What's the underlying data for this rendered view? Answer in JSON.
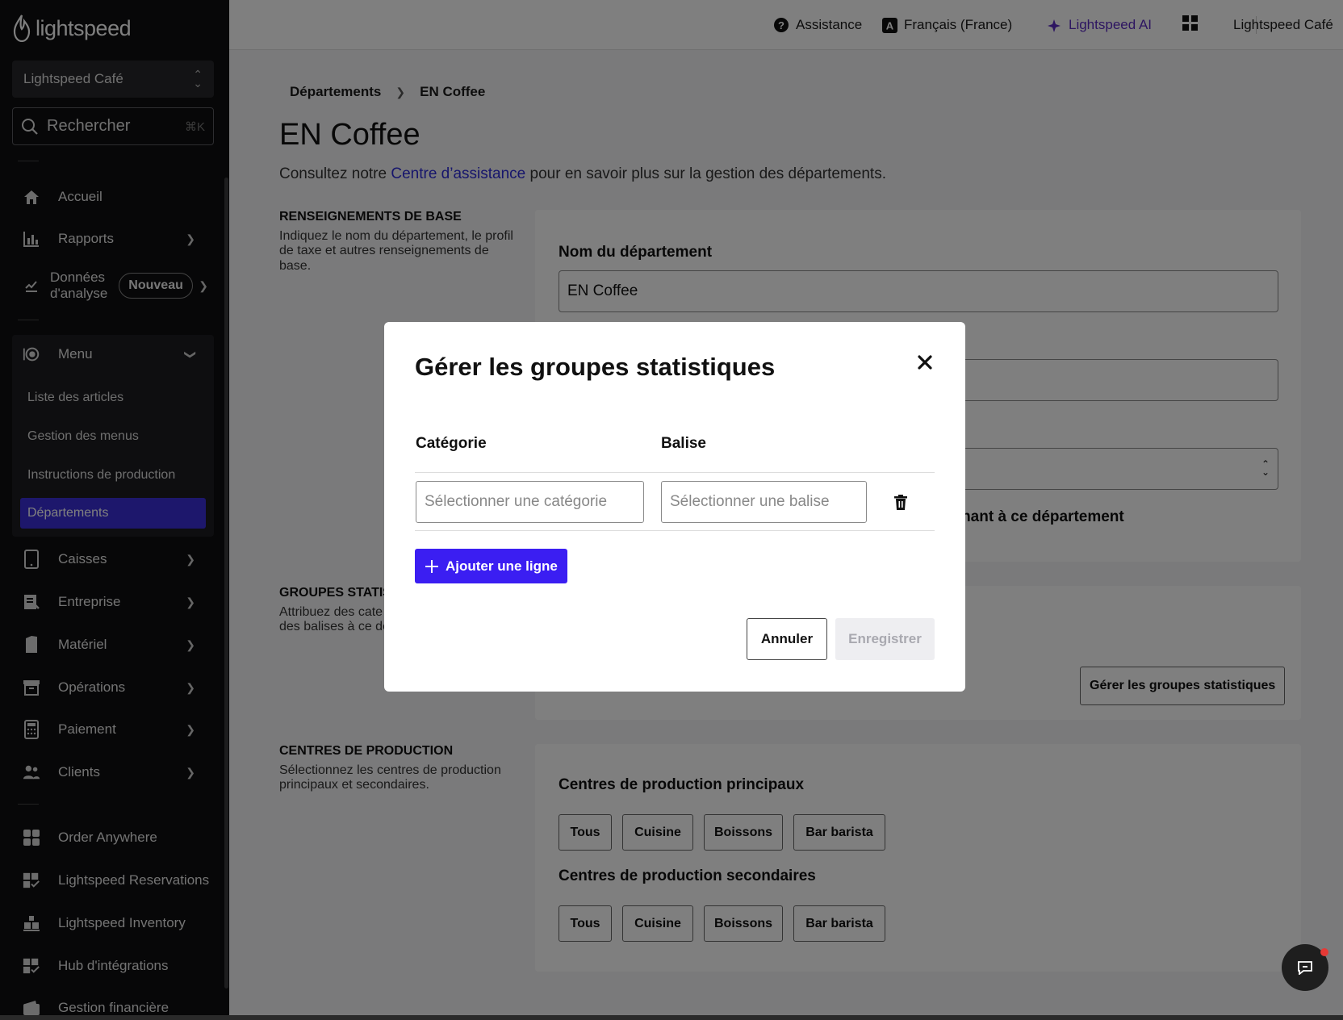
{
  "brand": {
    "name": "lightspeed"
  },
  "sidebar": {
    "venue": "Lightspeed Café",
    "search": {
      "label": "Rechercher",
      "shortcut": "⌘K"
    },
    "items": {
      "home": "Accueil",
      "reports": "Rapports",
      "analytics_line1": "Données",
      "analytics_line2": "d'analyse",
      "analytics_badge": "Nouveau",
      "menu": "Menu",
      "registers": "Caisses",
      "business": "Entreprise",
      "hardware": "Matériel",
      "operations": "Opérations",
      "payment": "Paiement",
      "clients": "Clients",
      "order_anywhere": "Order Anywhere",
      "reservations": "Lightspeed Reservations",
      "inventory": "Lightspeed Inventory",
      "integrations": "Hub d'intégrations",
      "finance": "Gestion financière"
    },
    "menu_sub": {
      "items_list": "Liste des articles",
      "menu_mgmt": "Gestion des menus",
      "production_instructions": "Instructions de production",
      "departments": "Départements"
    }
  },
  "topbar": {
    "help": "Assistance",
    "language": "Français (France)",
    "ai": "Lightspeed AI",
    "account": "Lightspeed Café"
  },
  "page": {
    "breadcrumb_parent": "Départements",
    "breadcrumb_current": "EN Coffee",
    "title": "EN Coffee",
    "help_prefix": "Consultez notre ",
    "help_link": "Centre d’assistance",
    "help_suffix": " pour en savoir plus sur la gestion des départements.",
    "basic": {
      "heading": "RENSEIGNEMENTS DE BASE",
      "desc": "Indiquez le nom du département, le profil de taxe et autres renseignements de base.",
      "name_label": "Nom du département",
      "name_value": "EN Coffee",
      "belongs_partial": "ppartenant à ce département"
    },
    "stats": {
      "heading_partial": "GROUPES STATIS",
      "desc_partial_1": "Attribuez des cate",
      "desc_partial_2": "des balises à ce dé",
      "manage_button": "Gérer les groupes statistiques"
    },
    "production": {
      "heading": "CENTRES DE PRODUCTION",
      "desc": "Sélectionnez les centres de production principaux et secondaires.",
      "primary_label": "Centres de production principaux",
      "secondary_label": "Centres de production secondaires",
      "chips": [
        "Tous",
        "Cuisine",
        "Boissons",
        "Bar barista"
      ]
    }
  },
  "modal": {
    "title": "Gérer les groupes statistiques",
    "col_category": "Catégorie",
    "col_tag": "Balise",
    "category_placeholder": "Sélectionner une catégorie",
    "tag_placeholder": "Sélectionner une balise",
    "add_row": "Ajouter une ligne",
    "cancel": "Annuler",
    "save": "Enregistrer"
  },
  "colors": {
    "sidebar_bg": "#0f0f10",
    "accent": "#3b1ef2",
    "active_nav": "#3b2fd8",
    "ai_purple": "#5b2bc2"
  }
}
